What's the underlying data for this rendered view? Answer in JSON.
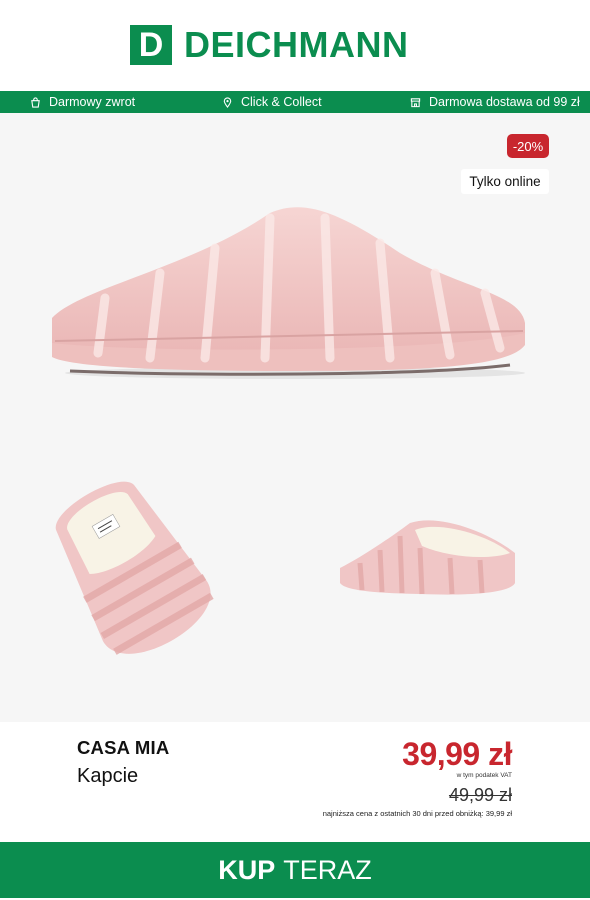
{
  "logo": {
    "mark": "D",
    "word": "DEICHMANN"
  },
  "benefits": [
    {
      "icon": "return-bag-icon",
      "label": "Darmowy zwrot"
    },
    {
      "icon": "location-pin-icon",
      "label": "Click & Collect"
    },
    {
      "icon": "store-icon",
      "label": "Darmowa dostawa od 99 zł"
    }
  ],
  "badges": {
    "discount": "-20%",
    "online": "Tylko online"
  },
  "product": {
    "brand": "CASA MIA",
    "type": "Kapcie",
    "price": "39,99 zł",
    "vat": "w tym podatek VAT",
    "old_price": "49,99 zł",
    "lowest_note": "najniższa cena z ostatnich 30 dni przed obniżką: 39,99 zł"
  },
  "cta": {
    "bold": "KUP",
    "light": "TERAZ"
  },
  "colors": {
    "brand_green": "#0b8d4f",
    "sale_red": "#c8262e",
    "slipper_pink": "#f0c6c6"
  }
}
